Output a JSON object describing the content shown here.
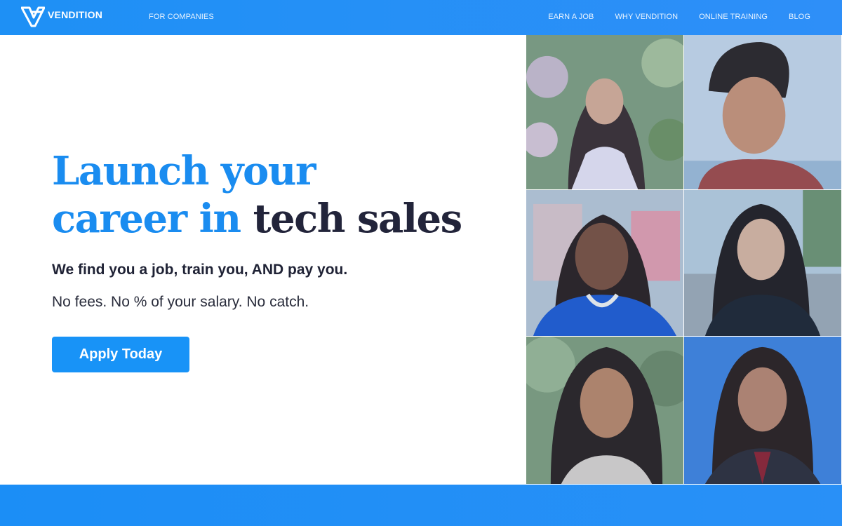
{
  "nav": {
    "brand": "VENDITION",
    "for_companies": "FOR COMPANIES",
    "links": [
      "EARN A JOB",
      "WHY VENDITION",
      "ONLINE TRAINING",
      "BLOG"
    ]
  },
  "hero": {
    "title_line1": "Launch your",
    "title_line2_blue": "career in",
    "title_line2_dark": "tech sales",
    "subhead": "We find you a job, train you, AND pay you.",
    "subtext": "No fees. No % of your salary. No catch.",
    "cta": "Apply Today"
  },
  "colors": {
    "brand_blue": "#1a8cf0",
    "dark_text": "#22243a",
    "button": "#1893f7"
  },
  "photos": {
    "count": 6
  }
}
